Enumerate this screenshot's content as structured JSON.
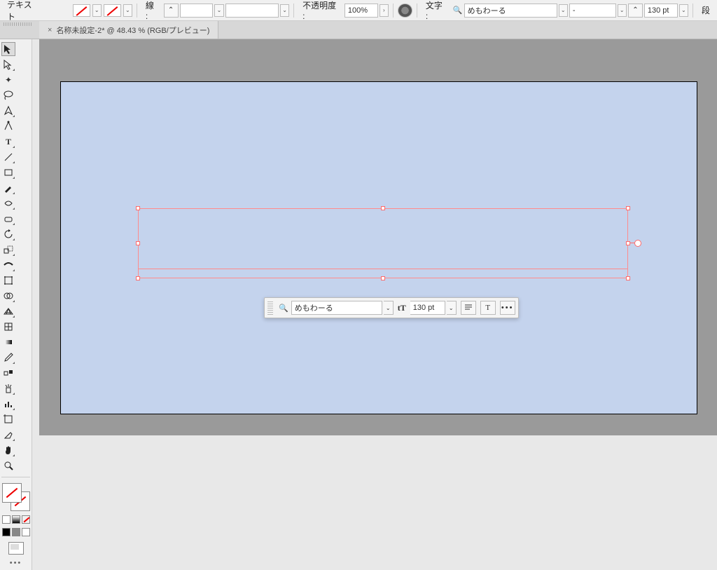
{
  "optionsBar": {
    "toolLabel": "テキスト",
    "strokeLabel": "線 :",
    "opacityLabel": "不透明度 :",
    "opacityValue": "100%",
    "charLabel": "文字 :",
    "fontName": "めもわーる",
    "fontStyle": "-",
    "fontSize": "130 pt",
    "paraLabel": "段"
  },
  "tab": {
    "closeGlyph": "×",
    "title": "名称未設定-2* @ 48.43 % (RGB/プレビュー)"
  },
  "float": {
    "fontName": "めもわーる",
    "sizeIcon": "tT",
    "fontSize": "130 pt",
    "more": "•••"
  },
  "toolbox": {
    "overflow": "•••"
  }
}
